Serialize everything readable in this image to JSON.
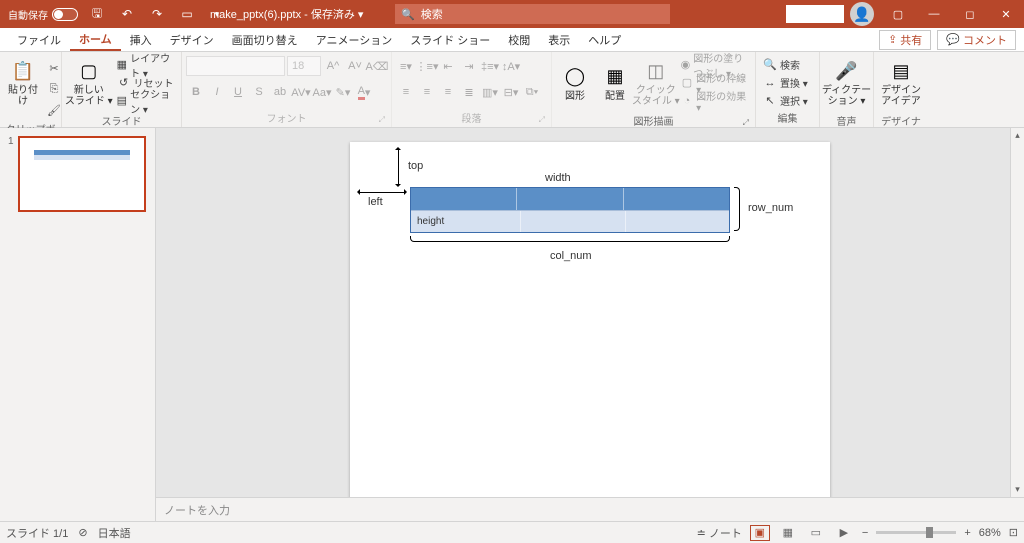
{
  "titlebar": {
    "autosave_label": "自動保存",
    "filename": "make_pptx(6).pptx - 保存済み ▾",
    "search_placeholder": "検索"
  },
  "tabs": {
    "file": "ファイル",
    "home": "ホーム",
    "insert": "挿入",
    "design": "デザイン",
    "transitions": "画面切り替え",
    "animations": "アニメーション",
    "slideshow": "スライド ショー",
    "review": "校閲",
    "view": "表示",
    "help": "ヘルプ",
    "share": "共有",
    "comment": "コメント"
  },
  "ribbon": {
    "clipboard": {
      "paste": "貼り付け",
      "label": "クリップボード"
    },
    "slides": {
      "newslide": "新しい\nスライド ▾",
      "layout": "レイアウト ▾",
      "reset": "リセット",
      "section": "セクション ▾",
      "label": "スライド"
    },
    "font": {
      "size": "18",
      "label": "フォント"
    },
    "paragraph": {
      "label": "段落"
    },
    "drawing": {
      "shapes": "図形",
      "arrange": "配置",
      "quick": "クイック\nスタイル ▾",
      "fill": "図形の塗りつぶし ▾",
      "outline": "図形の枠線 ▾",
      "effects": "図形の効果 ▾",
      "label": "図形描画"
    },
    "editing": {
      "find": "検索",
      "replace": "置換 ▾",
      "select": "選択 ▾",
      "label": "編集"
    },
    "voice": {
      "dictate": "ディクテー\nション ▾",
      "label": "音声"
    },
    "designer": {
      "ideas": "デザイン\nアイデア",
      "label": "デザイナー"
    }
  },
  "slide": {
    "top": "top",
    "left": "left",
    "width": "width",
    "height": "height",
    "row_num": "row_num",
    "col_num": "col_num"
  },
  "thumb": {
    "num": "1"
  },
  "notes": {
    "placeholder": "ノートを入力"
  },
  "status": {
    "slide": "スライド 1/1",
    "lang": "日本語",
    "notes_btn": "ノート",
    "zoom": "68%"
  }
}
